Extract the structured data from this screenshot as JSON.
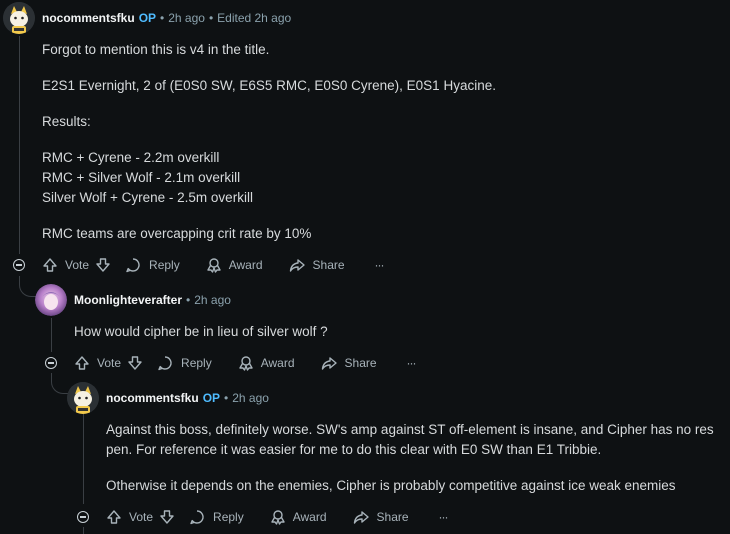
{
  "comments": [
    {
      "username": "nocommentsfku",
      "op_badge": "OP",
      "time": "2h ago",
      "edited": "Edited 2h ago",
      "body": [
        "Forgot to mention this is v4 in the title.",
        "E2S1 Evernight, 2 of (E0S0 SW, E6S5 RMC, E0S0 Cyrene), E0S1 Hyacine.",
        "Results:",
        "RMC + Cyrene - 2.2m overkill",
        "RMC + Silver Wolf - 2.1m overkill",
        "Silver Wolf + Cyrene - 2.5m overkill",
        "RMC teams are overcapping crit rate by 10%"
      ]
    },
    {
      "username": "Moonlighteverafter",
      "time": "2h ago",
      "body": [
        "How would cipher be in lieu of silver wolf ?"
      ]
    },
    {
      "username": "nocommentsfku",
      "op_badge": "OP",
      "time": "2h ago",
      "body": [
        "Against this boss, definitely worse. SW's amp against ST off-element is insane, and Cipher has no res",
        "pen. For reference it was easier for me to do this clear with E0 SW than E1 Tribbie.",
        "Otherwise it depends on the enemies, Cipher is probably competitive against ice weak enemies"
      ]
    }
  ],
  "actions": {
    "vote": "Vote",
    "reply": "Reply",
    "award": "Award",
    "share": "Share",
    "more": "···"
  },
  "separator": "•",
  "icons": [
    "upvote-icon",
    "downvote-icon",
    "reply-icon",
    "award-icon",
    "share-icon",
    "more-icon",
    "collapse-icon"
  ]
}
